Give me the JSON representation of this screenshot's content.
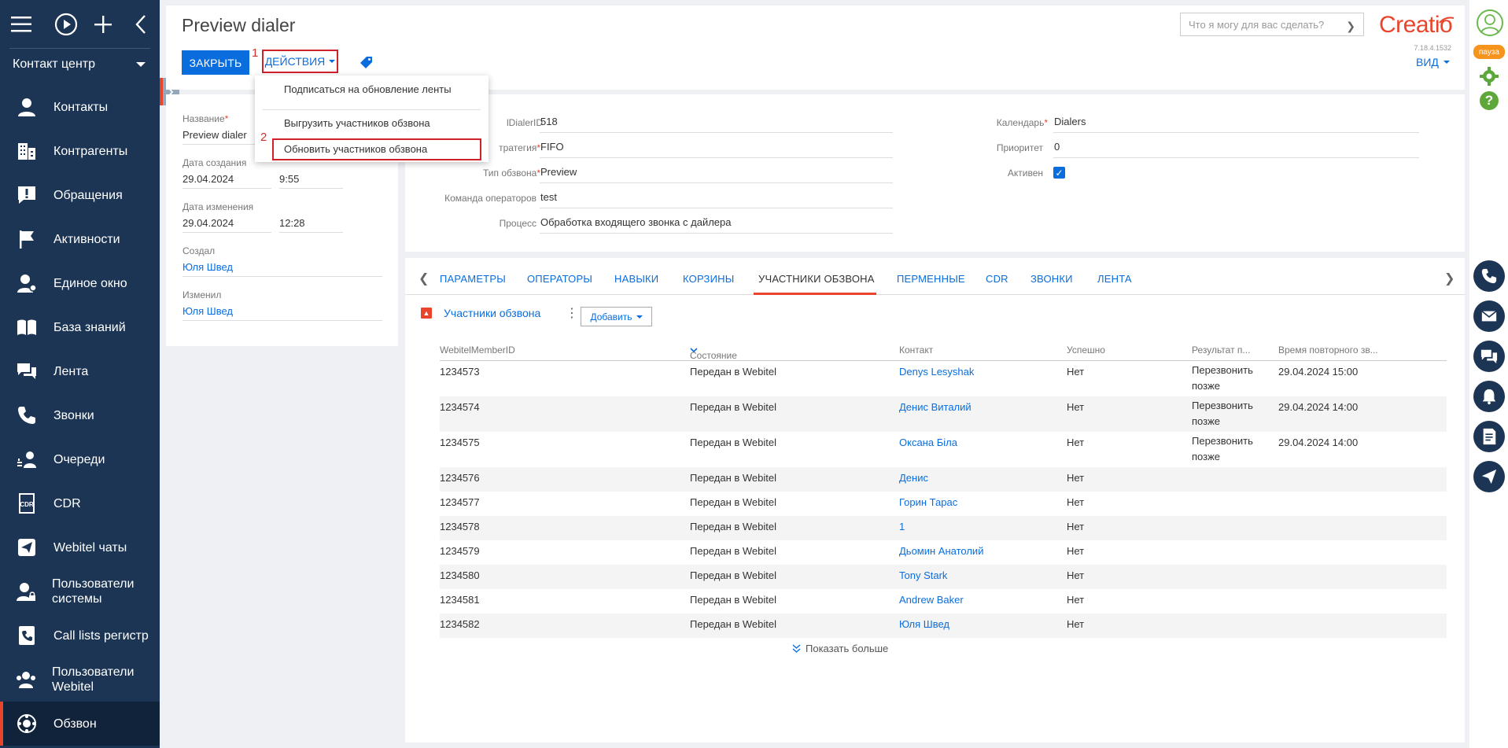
{
  "sidebar": {
    "section": "Контакт центр",
    "items": [
      {
        "label": "Контакты",
        "icon": "contact-icon"
      },
      {
        "label": "Контрагенты",
        "icon": "building-icon"
      },
      {
        "label": "Обращения",
        "icon": "exclamation-icon"
      },
      {
        "label": "Активности",
        "icon": "flag-icon"
      },
      {
        "label": "Единое окно",
        "icon": "person-gear-icon"
      },
      {
        "label": "База знаний",
        "icon": "book-icon"
      },
      {
        "label": "Лента",
        "icon": "chat-icon"
      },
      {
        "label": "Звонки",
        "icon": "phone-icon"
      },
      {
        "label": "Очереди",
        "icon": "queue-icon"
      },
      {
        "label": "CDR",
        "icon": "cdr-icon"
      },
      {
        "label": "Webitel чаты",
        "icon": "send-icon"
      },
      {
        "label": "Пользователи системы",
        "icon": "user-lock-icon"
      },
      {
        "label": "Call lists регистр",
        "icon": "phone-list-icon"
      },
      {
        "label": "Пользователи Webitel",
        "icon": "users-icon"
      },
      {
        "label": "Обзвон",
        "icon": "dialer-icon"
      }
    ]
  },
  "header": {
    "title": "Preview dialer",
    "close_label": "ЗАКРЫТЬ",
    "actions_label": "ДЕЙСТВИЯ",
    "mark1": "1",
    "mark2": "2",
    "search_placeholder": "Что я могу для вас сделать?",
    "logo": "Creatio",
    "version": "7.18.4.1532",
    "view_label": "ВИД"
  },
  "dropdown": {
    "items": [
      "Подписаться на обновление ленты",
      "Выгрузить участников обзвона",
      "Обновить участников обзвона"
    ]
  },
  "left_panel": {
    "name_label": "Название",
    "name_value": "Preview dialer",
    "created_label": "Дата создания",
    "created_date": "29.04.2024",
    "created_time": "9:55",
    "modified_label": "Дата изменения",
    "modified_date": "29.04.2024",
    "modified_time": "12:28",
    "created_by_label": "Создал",
    "created_by": "Юля Швед",
    "modified_by_label": "Изменил",
    "modified_by": "Юля Швед"
  },
  "fields": {
    "dialer_id_label": "lDialerID",
    "dialer_id": "518",
    "strategy_label": "тратегия",
    "strategy": "FIFO",
    "type_label": "Тип обзвона",
    "type": "Preview",
    "team_label": "Команда операторов",
    "team": "test",
    "process_label": "Процесс",
    "process": "Обработка входящего звонка с дайлера",
    "calendar_label": "Календарь",
    "calendar": "Dialers",
    "priority_label": "Приоритет",
    "priority": "0",
    "active_label": "Активен",
    "active_check": "✓"
  },
  "tabs": [
    "ПАРАМЕТРЫ",
    "ОПЕРАТОРЫ",
    "НАВЫКИ",
    "КОРЗИНЫ",
    "УЧАСТНИКИ ОБЗВОНА",
    "ПЕРМЕННЫЕ",
    "CDR",
    "ЗВОНКИ",
    "ЛЕНТА"
  ],
  "detail": {
    "title": "Участники обзвона",
    "add_label": "Добавить",
    "columns": [
      "WebitelMemberID",
      "Состояние",
      "Контакт",
      "Успешно",
      "Результат п...",
      "Время повторного зв..."
    ],
    "rows": [
      {
        "id": "1234573",
        "state": "Передан в Webitel",
        "contact": "Denys Lesyshak",
        "success": "Нет",
        "result": "Перезвонить позже",
        "retry": "29.04.2024 15:00"
      },
      {
        "id": "1234574",
        "state": "Передан в Webitel",
        "contact": "Денис Виталий",
        "success": "Нет",
        "result": "Перезвонить позже",
        "retry": "29.04.2024 14:00"
      },
      {
        "id": "1234575",
        "state": "Передан в Webitel",
        "contact": "Оксана Біла",
        "success": "Нет",
        "result": "Перезвонить позже",
        "retry": "29.04.2024 14:00"
      },
      {
        "id": "1234576",
        "state": "Передан в Webitel",
        "contact": "Денис",
        "success": "Нет",
        "result": "",
        "retry": ""
      },
      {
        "id": "1234577",
        "state": "Передан в Webitel",
        "contact": "Горин Тарас",
        "success": "Нет",
        "result": "",
        "retry": ""
      },
      {
        "id": "1234578",
        "state": "Передан в Webitel",
        "contact": "1",
        "success": "Нет",
        "result": "",
        "retry": ""
      },
      {
        "id": "1234579",
        "state": "Передан в Webitel",
        "contact": "Дьомин Анатолий",
        "success": "Нет",
        "result": "",
        "retry": ""
      },
      {
        "id": "1234580",
        "state": "Передан в Webitel",
        "contact": "Tony Stark",
        "success": "Нет",
        "result": "",
        "retry": ""
      },
      {
        "id": "1234581",
        "state": "Передан в Webitel",
        "contact": "Andrew Baker",
        "success": "Нет",
        "result": "",
        "retry": ""
      },
      {
        "id": "1234582",
        "state": "Передан в Webitel",
        "contact": "Юля Швед",
        "success": "Нет",
        "result": "",
        "retry": ""
      }
    ],
    "show_more": "Показать больше"
  },
  "right_bar": {
    "pause_label": "пауза"
  },
  "colors": {
    "sidebar_bg": "#1c3554",
    "accent_blue": "#0a6dde",
    "accent_red": "#e8452c",
    "highlight_red": "#d0212b"
  }
}
